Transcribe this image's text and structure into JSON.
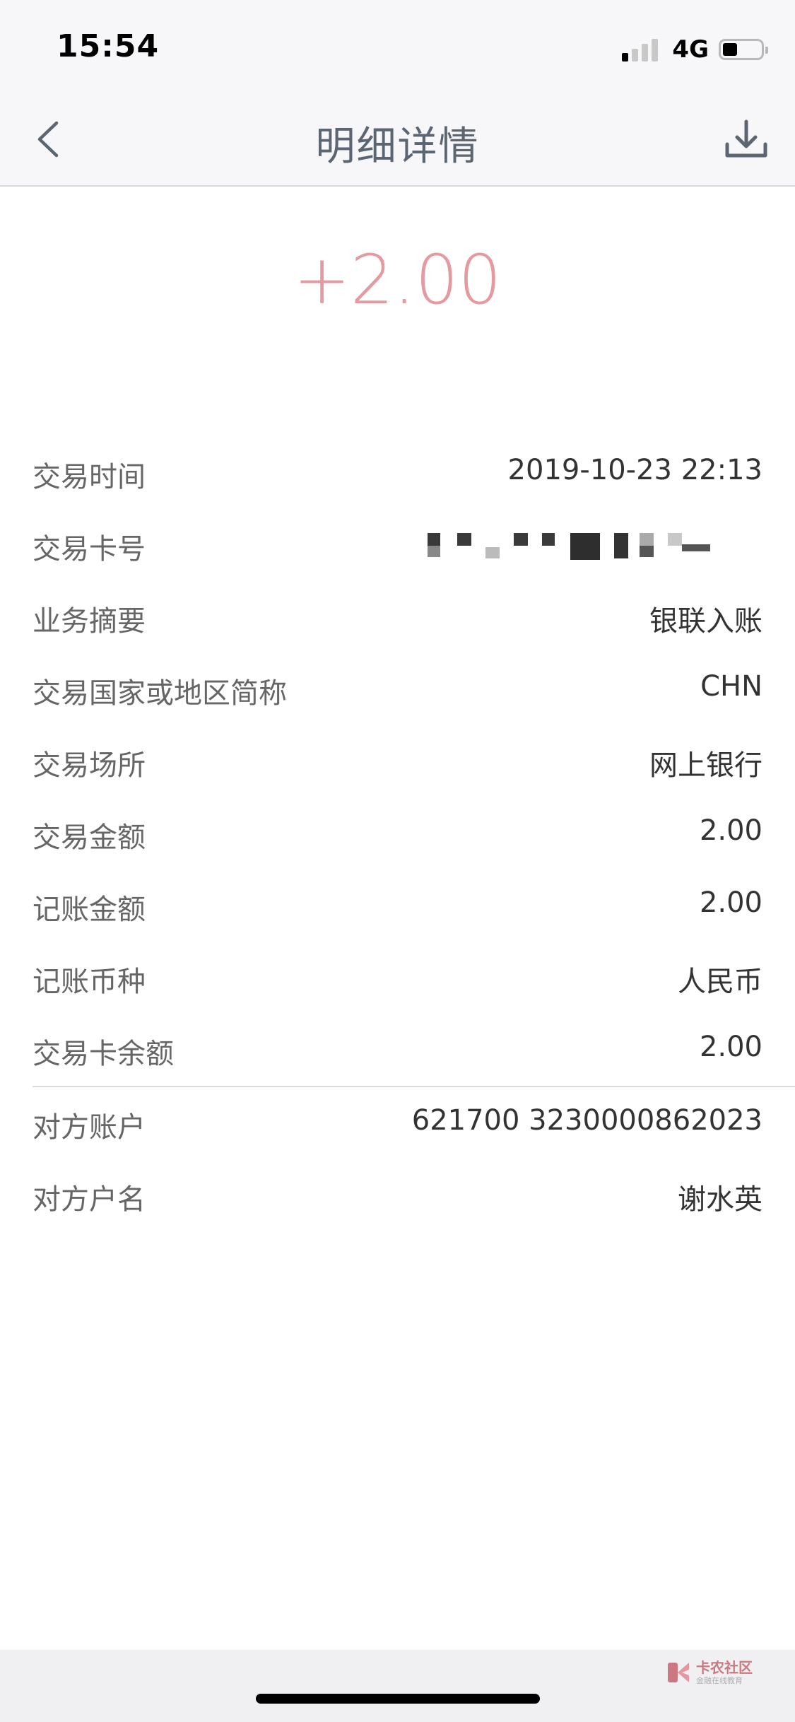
{
  "status_bar": {
    "time": "15:54",
    "network": "4G",
    "signal_bars_active": 1,
    "battery_level": 0.35
  },
  "nav": {
    "title": "明细详情",
    "back_icon": "chevron-left-icon",
    "download_icon": "download-icon"
  },
  "amount": {
    "value": "+2.00",
    "color": "#e59aa0"
  },
  "details": {
    "rows": [
      {
        "label": "交易时间",
        "value": "2019-10-23 22:13"
      },
      {
        "label": "交易卡号",
        "value": ""
      },
      {
        "label": "业务摘要",
        "value": "银联入账"
      },
      {
        "label": "交易国家或地区简称",
        "value": "CHN"
      },
      {
        "label": "交易场所",
        "value": "网上银行"
      },
      {
        "label": "交易金额",
        "value": "2.00"
      },
      {
        "label": "记账金额",
        "value": "2.00"
      },
      {
        "label": "记账币种",
        "value": "人民币"
      },
      {
        "label": "交易卡余额",
        "value": "2.00"
      }
    ],
    "counterparty": [
      {
        "label": "对方账户",
        "value": "621700 3230000862023"
      },
      {
        "label": "对方户名",
        "value": "谢水英"
      }
    ]
  },
  "watermark": {
    "title": "卡农社区",
    "subtitle": "金融在线教育"
  }
}
